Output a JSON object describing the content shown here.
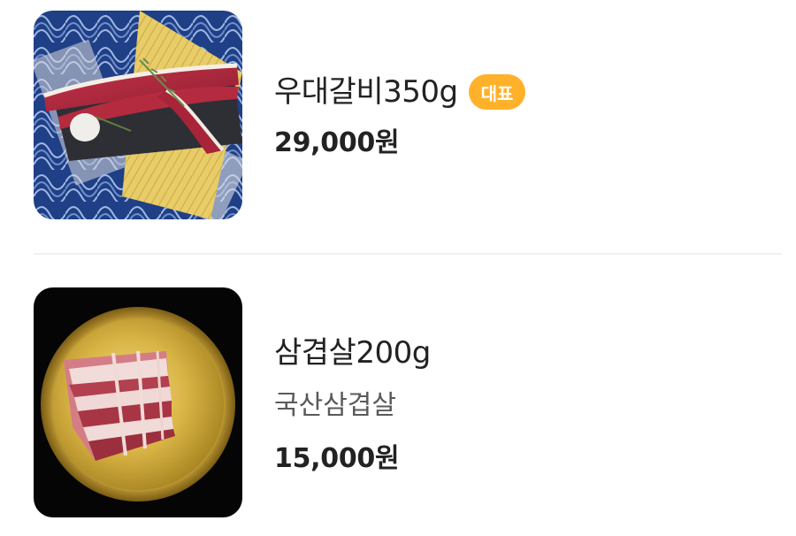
{
  "menu_items": [
    {
      "name": "우대갈비350g",
      "badge": "대표",
      "price": "29,000원",
      "image_icon": "beef-ribs-photo"
    },
    {
      "name": "삼겹살200g",
      "description": "국산삼겹살",
      "price": "15,000원",
      "image_icon": "pork-belly-photo"
    }
  ],
  "colors": {
    "badge_bg": "#ffb12a",
    "badge_text": "#ffffff",
    "divider": "#f0f0f0"
  }
}
